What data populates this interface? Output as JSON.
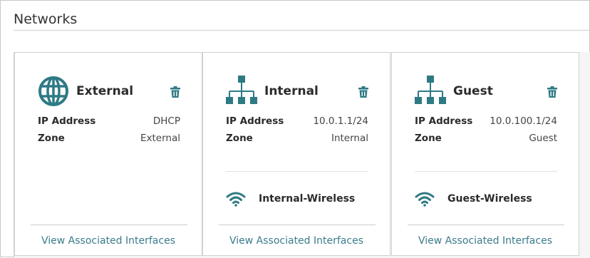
{
  "page": {
    "title": "Networks"
  },
  "colors": {
    "accent": "#2e7a84",
    "link": "#3a7b8c"
  },
  "networks": [
    {
      "name": "External",
      "icon": "globe-icon",
      "ip_label": "IP Address",
      "ip_value": "DHCP",
      "zone_label": "Zone",
      "zone_value": "External",
      "wireless": null,
      "link_label": "View Associated Interfaces"
    },
    {
      "name": "Internal",
      "icon": "network-hierarchy-icon",
      "ip_label": "IP Address",
      "ip_value": "10.0.1.1/24",
      "zone_label": "Zone",
      "zone_value": "Internal",
      "wireless": "Internal-Wireless",
      "link_label": "View Associated Interfaces"
    },
    {
      "name": "Guest",
      "icon": "network-hierarchy-icon",
      "ip_label": "IP Address",
      "ip_value": "10.0.100.1/24",
      "zone_label": "Zone",
      "zone_value": "Guest",
      "wireless": "Guest-Wireless",
      "link_label": "View Associated Interfaces"
    }
  ]
}
